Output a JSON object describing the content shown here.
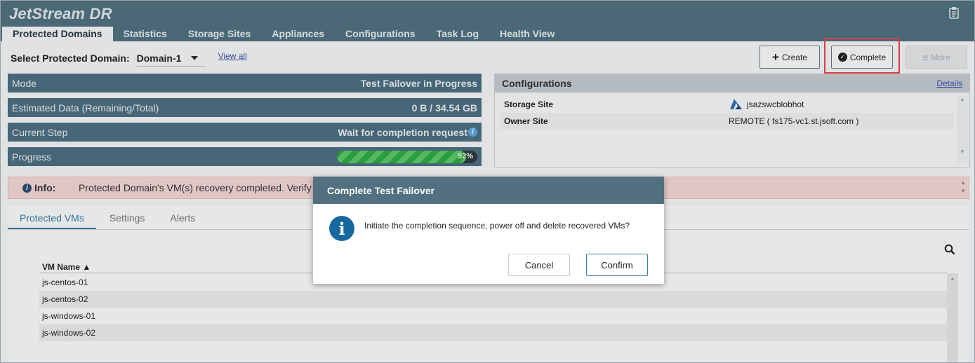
{
  "app": {
    "title": "JetStream DR"
  },
  "nav": {
    "items": [
      {
        "label": "Protected Domains",
        "active": true
      },
      {
        "label": "Statistics"
      },
      {
        "label": "Storage Sites"
      },
      {
        "label": "Appliances"
      },
      {
        "label": "Configurations"
      },
      {
        "label": "Task Log"
      },
      {
        "label": "Health View"
      }
    ]
  },
  "domain_select": {
    "label": "Select Protected Domain:",
    "value": "Domain-1",
    "view_all": "View all"
  },
  "toolbar": {
    "create": "Create",
    "complete": "Complete",
    "more": "More"
  },
  "status": {
    "mode": {
      "label": "Mode",
      "value": "Test Failover in Progress"
    },
    "estimated": {
      "label": "Estimated Data (Remaining/Total)",
      "value": "0 B / 34.54 GB"
    },
    "current_step": {
      "label": "Current Step",
      "value": "Wait for completion request"
    },
    "progress": {
      "label": "Progress",
      "percent": 92,
      "percent_text": "92%"
    }
  },
  "configurations": {
    "title": "Configurations",
    "details_link": "Details",
    "rows": [
      {
        "key": "Storage Site",
        "value": "jsazswcblobhot"
      },
      {
        "key": "Owner Site",
        "value": "REMOTE ( fs175-vc1.st.jsoft.com )"
      }
    ]
  },
  "info_banner": {
    "title": "Info:",
    "message": "Protected Domain's VM(s) recovery completed. Verify"
  },
  "tabs": [
    "Protected VMs",
    "Settings",
    "Alerts"
  ],
  "vm_table": {
    "column": "VM Name ▲",
    "rows": [
      "js-centos-01",
      "js-centos-02",
      "js-windows-01",
      "js-windows-02"
    ]
  },
  "modal": {
    "title": "Complete Test Failover",
    "message": "Initiate the completion sequence, power off and delete recovered VMs?",
    "cancel": "Cancel",
    "confirm": "Confirm"
  },
  "colors": {
    "header": "#50707f",
    "status_bar": "#4d6e80",
    "highlight": "#e5484d",
    "progress": "#2eaa3f",
    "info_banner": "#f3d6d6",
    "modal_icon": "#16699e"
  }
}
